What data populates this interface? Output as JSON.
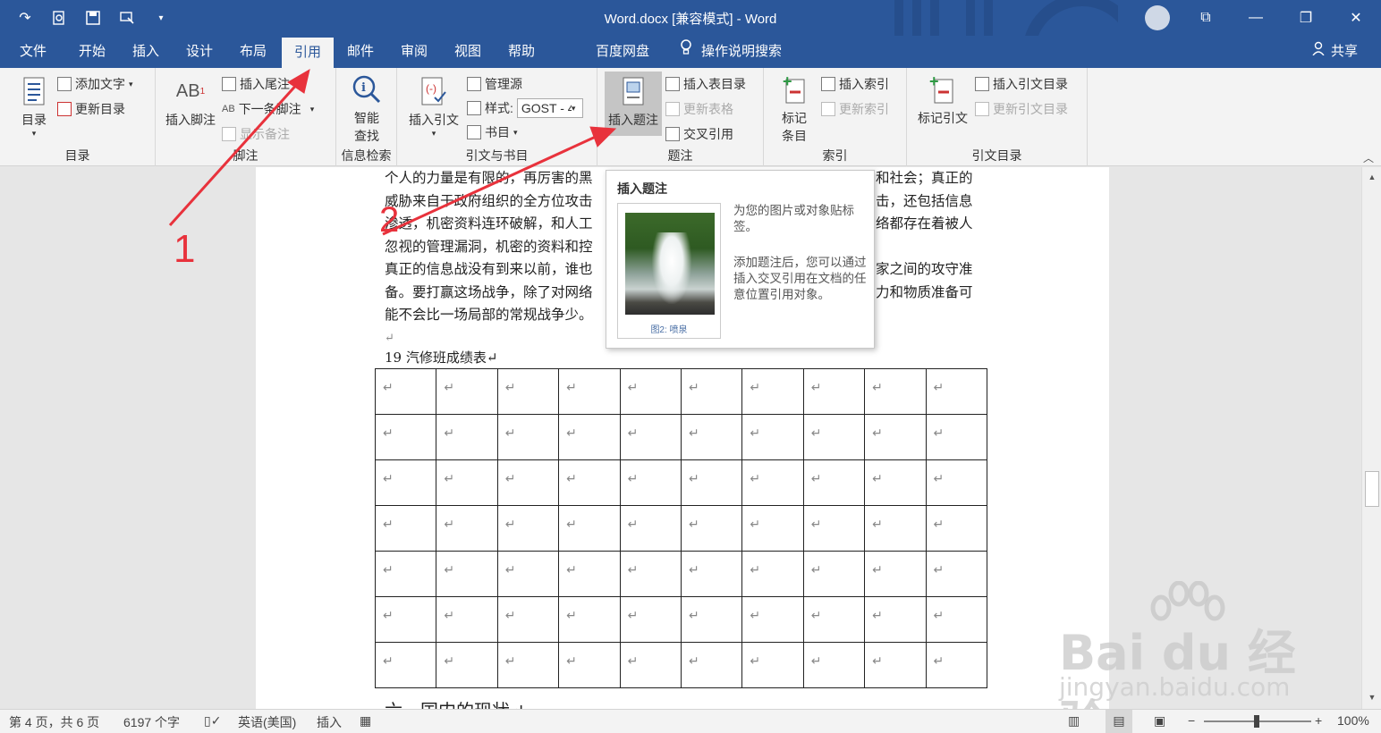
{
  "window": {
    "title": "Word.docx [兼容模式]  -  Word",
    "share_label": "共享"
  },
  "tabs": [
    "文件",
    "开始",
    "插入",
    "设计",
    "布局",
    "引用",
    "邮件",
    "审阅",
    "视图",
    "帮助",
    "百度网盘",
    "操作说明搜索"
  ],
  "active_tab": "引用",
  "ribbon": {
    "toc": {
      "big_label": "目录",
      "add_text": "添加文字",
      "update_toc": "更新目录",
      "group_label": "目录"
    },
    "footnotes": {
      "insert_footnote": "插入脚注",
      "insert_endnote": "插入尾注",
      "next_footnote": "下一条脚注",
      "show_notes": "显示备注",
      "group_label": "脚注"
    },
    "research": {
      "smart_lookup_1": "智能",
      "smart_lookup_2": "查找",
      "group_label": "信息检索"
    },
    "citations": {
      "insert_citation": "插入引文",
      "manage_sources": "管理源",
      "style_label": "样式:",
      "style_value": "GOST - 4",
      "bibliography": "书目",
      "group_label": "引文与书目"
    },
    "captions": {
      "insert_caption": "插入题注",
      "insert_table_of_figures": "插入表目录",
      "update_table": "更新表格",
      "cross_reference": "交叉引用",
      "group_label": "题注"
    },
    "index": {
      "mark_entry_1": "标记",
      "mark_entry_2": "条目",
      "insert_index": "插入索引",
      "update_index": "更新索引",
      "group_label": "索引"
    },
    "toa": {
      "mark_citation": "标记引文",
      "insert_toa": "插入引文目录",
      "update_toa": "更新引文目录",
      "group_label": "引文目录"
    }
  },
  "document": {
    "lines": [
      "个人的力量是有限的，再厉害的黑",
      "威胁来自于政府组织的全方位攻击",
      "渗透，机密资料连环破解，和人工",
      "忽视的管理漏洞，机密的资料和控",
      "真正的信息战没有到来以前，谁也",
      "备。要打赢这场战争，除了对网络",
      "能不会比一场局部的常规战争少。"
    ],
    "lines_right": [
      "和社会；真正的",
      "击，还包括信息",
      "络都存在着被人",
      "",
      "家之间的攻守准",
      "力和物质准备可",
      ""
    ],
    "empty_mark": "↵",
    "caption": "19 汽修班成绩表↵",
    "table_rows": 7,
    "table_cols": 10,
    "cell_mark": "↵",
    "next_heading": "六、国内的现状↵"
  },
  "tooltip": {
    "title": "插入题注",
    "desc1": "为您的图片或对象贴标签。",
    "desc2": "添加题注后，您可以通过插入交叉引用在文档的任意位置引用对象。",
    "preview_caption": "图2: 喷泉"
  },
  "annotations": {
    "step1": "1",
    "step2": "2",
    "arrow_color": "#e8323c"
  },
  "watermark": {
    "brand": "Bai du 经验",
    "url": "jingyan.baidu.com"
  },
  "status": {
    "page": "第 4 页，共 6 页",
    "words": "6197 个字",
    "language": "英语(美国)",
    "mode": "插入",
    "zoom": "100%"
  },
  "colors": {
    "brand": "#2b579a",
    "ribbon_bg": "#f3f3f3"
  }
}
